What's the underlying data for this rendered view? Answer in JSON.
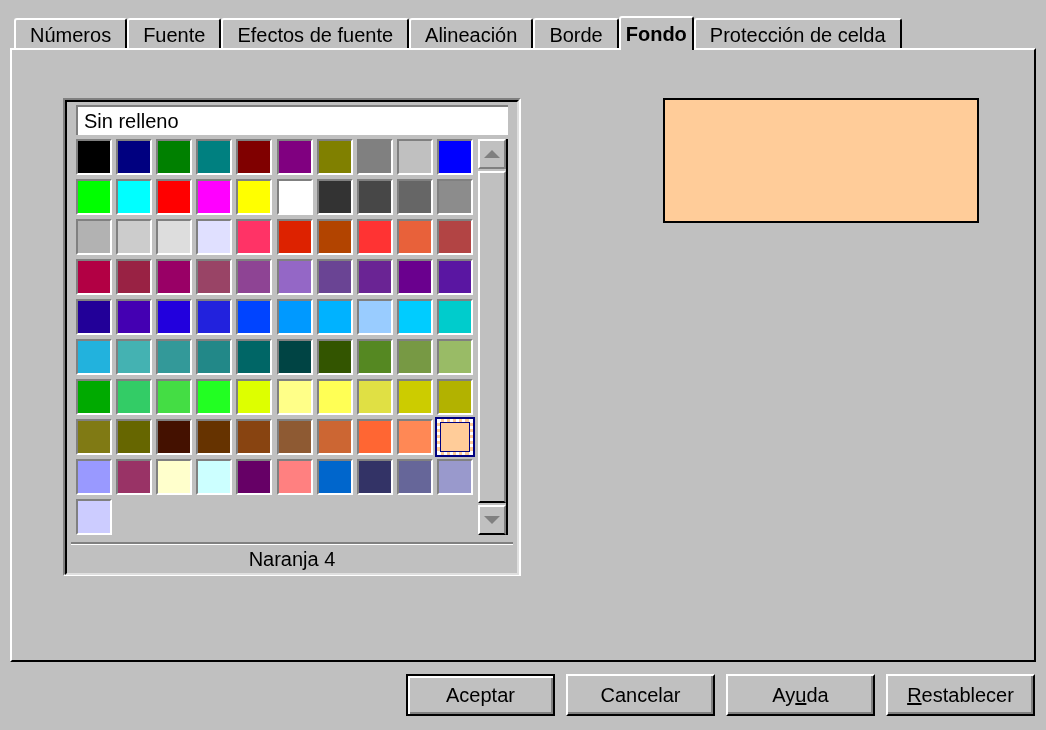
{
  "tabs": [
    {
      "label": "Números",
      "selected": false
    },
    {
      "label": "Fuente",
      "selected": false
    },
    {
      "label": "Efectos de fuente",
      "selected": false
    },
    {
      "label": "Alineación",
      "selected": false
    },
    {
      "label": "Borde",
      "selected": false
    },
    {
      "label": "Fondo",
      "selected": true
    },
    {
      "label": "Protección de celda",
      "selected": false
    }
  ],
  "palette": {
    "name_field": "Sin relleno",
    "swatches": [
      {
        "color": "#000000",
        "selected": false
      },
      {
        "color": "#000080",
        "selected": false
      },
      {
        "color": "#008000",
        "selected": false
      },
      {
        "color": "#008080",
        "selected": false
      },
      {
        "color": "#800000",
        "selected": false
      },
      {
        "color": "#800080",
        "selected": false
      },
      {
        "color": "#808000",
        "selected": false
      },
      {
        "color": "#808080",
        "selected": false
      },
      {
        "color": "#c0c0c0",
        "selected": false
      },
      {
        "color": "#0000ff",
        "selected": false
      },
      {
        "color": "#00ff00",
        "selected": false
      },
      {
        "color": "#00ffff",
        "selected": false
      },
      {
        "color": "#ff0000",
        "selected": false
      },
      {
        "color": "#ff00ff",
        "selected": false
      },
      {
        "color": "#ffff00",
        "selected": false
      },
      {
        "color": "#ffffff",
        "selected": false
      },
      {
        "color": "#333333",
        "selected": false
      },
      {
        "color": "#474747",
        "selected": false
      },
      {
        "color": "#666666",
        "selected": false
      },
      {
        "color": "#8c8c8c",
        "selected": false
      },
      {
        "color": "#b2b2b2",
        "selected": false
      },
      {
        "color": "#cccccc",
        "selected": false
      },
      {
        "color": "#dddddd",
        "selected": false
      },
      {
        "color": "#e0e0ff",
        "selected": false
      },
      {
        "color": "#ff3366",
        "selected": false
      },
      {
        "color": "#dd2200",
        "selected": false
      },
      {
        "color": "#b24400",
        "selected": false
      },
      {
        "color": "#ff3333",
        "selected": false
      },
      {
        "color": "#e8613a",
        "selected": false
      },
      {
        "color": "#b24444",
        "selected": false
      },
      {
        "color": "#b20044",
        "selected": false
      },
      {
        "color": "#992244",
        "selected": false
      },
      {
        "color": "#990066",
        "selected": false
      },
      {
        "color": "#994466",
        "selected": false
      },
      {
        "color": "#8e4494",
        "selected": false
      },
      {
        "color": "#9467c6",
        "selected": false
      },
      {
        "color": "#6a4494",
        "selected": false
      },
      {
        "color": "#6a2494",
        "selected": false
      },
      {
        "color": "#6a008e",
        "selected": false
      },
      {
        "color": "#5a16a2",
        "selected": false
      },
      {
        "color": "#220098",
        "selected": false
      },
      {
        "color": "#4400b2",
        "selected": false
      },
      {
        "color": "#2200dd",
        "selected": false
      },
      {
        "color": "#2222dd",
        "selected": false
      },
      {
        "color": "#0044ff",
        "selected": false
      },
      {
        "color": "#0099ff",
        "selected": false
      },
      {
        "color": "#00b2ff",
        "selected": false
      },
      {
        "color": "#99ccff",
        "selected": false
      },
      {
        "color": "#00ccff",
        "selected": false
      },
      {
        "color": "#00cccc",
        "selected": false
      },
      {
        "color": "#22b2dd",
        "selected": false
      },
      {
        "color": "#44b2b2",
        "selected": false
      },
      {
        "color": "#339999",
        "selected": false
      },
      {
        "color": "#228888",
        "selected": false
      },
      {
        "color": "#006666",
        "selected": false
      },
      {
        "color": "#004444",
        "selected": false
      },
      {
        "color": "#335500",
        "selected": false
      },
      {
        "color": "#558822",
        "selected": false
      },
      {
        "color": "#779944",
        "selected": false
      },
      {
        "color": "#99bb66",
        "selected": false
      },
      {
        "color": "#00aa00",
        "selected": false
      },
      {
        "color": "#33cc66",
        "selected": false
      },
      {
        "color": "#44dd44",
        "selected": false
      },
      {
        "color": "#22ff22",
        "selected": false
      },
      {
        "color": "#ddff00",
        "selected": false
      },
      {
        "color": "#ffff88",
        "selected": false
      },
      {
        "color": "#ffff55",
        "selected": false
      },
      {
        "color": "#e0e044",
        "selected": false
      },
      {
        "color": "#cccc00",
        "selected": false
      },
      {
        "color": "#b2b200",
        "selected": false
      },
      {
        "color": "#807a14",
        "selected": false
      },
      {
        "color": "#666600",
        "selected": false
      },
      {
        "color": "#441100",
        "selected": false
      },
      {
        "color": "#663300",
        "selected": false
      },
      {
        "color": "#884411",
        "selected": false
      },
      {
        "color": "#8e5a33",
        "selected": false
      },
      {
        "color": "#cc6633",
        "selected": false
      },
      {
        "color": "#ff6633",
        "selected": false
      },
      {
        "color": "#ff8855",
        "selected": false
      },
      {
        "color": "#ffcc99",
        "selected": true
      },
      {
        "color": "#9999ff",
        "selected": false
      },
      {
        "color": "#993366",
        "selected": false
      },
      {
        "color": "#ffffcc",
        "selected": false
      },
      {
        "color": "#ccffff",
        "selected": false
      },
      {
        "color": "#660066",
        "selected": false
      },
      {
        "color": "#ff8080",
        "selected": false
      },
      {
        "color": "#0066cc",
        "selected": false
      },
      {
        "color": "#333366",
        "selected": false
      },
      {
        "color": "#666699",
        "selected": false
      },
      {
        "color": "#9999cc",
        "selected": false
      },
      {
        "color": "#ccccff",
        "selected": false
      }
    ],
    "color_name": "Naranja 4"
  },
  "preview": {
    "color": "#ffcc99"
  },
  "buttons": [
    {
      "label": "Aceptar",
      "default": true
    },
    {
      "label": "Cancelar",
      "default": false
    },
    {
      "label_parts": [
        {
          "text": "Ay",
          "underlined": false
        },
        {
          "text": "u",
          "underlined": true
        },
        {
          "text": "da",
          "underlined": false
        }
      ],
      "default": false
    },
    {
      "label_parts": [
        {
          "text": "R",
          "underlined": true
        },
        {
          "text": "establecer",
          "underlined": false
        }
      ],
      "default": false
    }
  ]
}
